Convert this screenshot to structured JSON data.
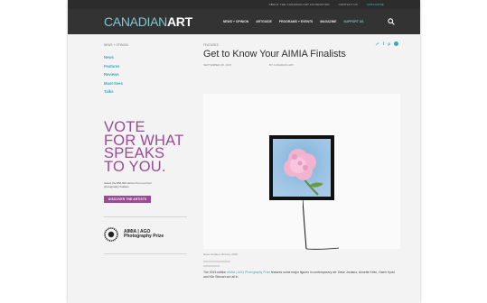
{
  "topbar": {
    "links": [
      "ABOUT THE CANADIAN ART FOUNDATION",
      "CONTACT US",
      "SUBSCRIBE"
    ]
  },
  "header": {
    "logo_part1": "CANADIAN",
    "logo_part2": "ART",
    "nav": [
      "NEWS + OPINION",
      "ARTGUIDE",
      "PROGRAMS + EVENTS",
      "MAGAZINE",
      "SUPPORT US"
    ]
  },
  "sidebar": {
    "breadcrumb": "NEWS + OPINION",
    "items": [
      "News",
      "Features",
      "Reviews",
      "Must-Sees",
      "Talks"
    ],
    "vote_lines": [
      "VOTE",
      "FOR WHAT",
      "SPEAKS",
      "TO YOU."
    ],
    "vote_description": "Select the $50,000 winner from our four photography finalists.",
    "vote_button": "DISCOVER THE ARTISTS",
    "prize_name_line1": "AIMIA | AGO",
    "prize_name_line2": "Photography Prize"
  },
  "article": {
    "section": "FEATURES",
    "title": "Get to Know Your AIMIA Finalists",
    "date": "SEPTEMBER 28, 2015",
    "byline": "BY CANADIAN ART",
    "caption": "Dave Jordano, Brandy, 2015",
    "body_intro": "The 2015 edition",
    "body_link": "AIMIA | AGO Photography Prize",
    "body_rest": "features some major figures in contemporary art: Dave Jordano, Annette Kelm, Owen Kydd and Kilo Stewart are all in"
  },
  "colors": {
    "accent": "#3ea7b6",
    "vote": "#9b4a95",
    "header_bg": "#333333"
  }
}
